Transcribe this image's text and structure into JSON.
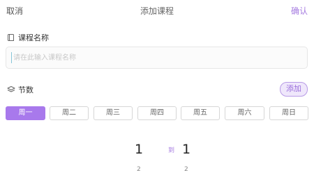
{
  "header": {
    "cancel": "取消",
    "title": "添加课程",
    "confirm": "确认"
  },
  "course_name": {
    "label": "课程名称",
    "placeholder": "请在此输入课程名称",
    "value": "",
    "icon": "book-icon"
  },
  "sessions": {
    "label": "节数",
    "icon": "layers-icon",
    "add_button": "添加"
  },
  "weekdays": {
    "items": [
      "周一",
      "周二",
      "周三",
      "周四",
      "周五",
      "周六",
      "周日"
    ],
    "selected": "周一",
    "accent_color": "#a879ec"
  },
  "period_picker": {
    "start": {
      "current": "1",
      "next": "2"
    },
    "separator": "到",
    "end": {
      "current": "1",
      "next": "2"
    }
  }
}
